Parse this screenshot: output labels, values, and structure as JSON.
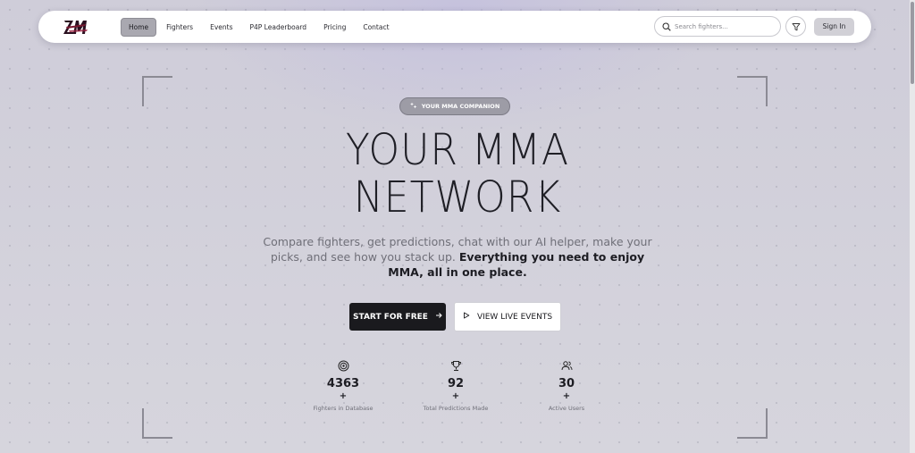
{
  "nav": {
    "logo_alt": "logo",
    "items": [
      {
        "label": "Home",
        "active": true
      },
      {
        "label": "Fighters",
        "active": false
      },
      {
        "label": "Events",
        "active": false
      },
      {
        "label": "P4P Leaderboard",
        "active": false
      },
      {
        "label": "Pricing",
        "active": false
      },
      {
        "label": "Contact",
        "active": false
      }
    ],
    "search_placeholder": "Search fighters...",
    "signin_label": "Sign In"
  },
  "hero": {
    "badge": "YOUR MMA COMPANION",
    "title_line1": "YOUR MMA",
    "title_line2": "NETWORK",
    "subtitle_plain": "Compare fighters, get predictions, chat with our AI helper, make your picks, and see how you stack up. ",
    "subtitle_bold": "Everything you need to enjoy MMA, all in one place.",
    "cta_primary": "START FOR FREE",
    "cta_secondary": "VIEW LIVE EVENTS"
  },
  "stats": [
    {
      "icon": "target-icon",
      "value": "4363",
      "suffix": "+",
      "label": "Fighters in Database"
    },
    {
      "icon": "trophy-icon",
      "value": "92",
      "suffix": "+",
      "label": "Total Predictions Made"
    },
    {
      "icon": "users-icon",
      "value": "30",
      "suffix": "+",
      "label": "Active Users"
    }
  ],
  "colors": {
    "background": "#d3d2dc",
    "primary_button": "#1a1a1e",
    "badge": "#9d9ca6",
    "logo_accent": "#7a1830"
  }
}
